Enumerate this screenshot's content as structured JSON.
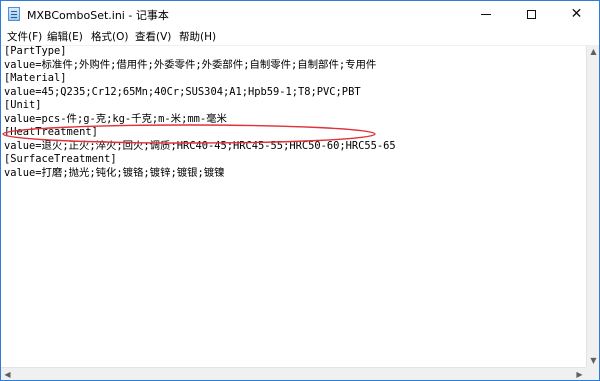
{
  "window": {
    "title": "MXBComboSet.ini - 记事本"
  },
  "titlebar_buttons": {
    "minimize_icon": "minimize-icon",
    "maximize_icon": "maximize-icon",
    "close": "✕"
  },
  "menu": [
    {
      "label": "文件(F)"
    },
    {
      "label": "编辑(E)"
    },
    {
      "label": "格式(O)"
    },
    {
      "label": "查看(V)"
    },
    {
      "label": "帮助(H)"
    }
  ],
  "document": {
    "lines": [
      "[PartType]",
      "value=标准件;外购件;借用件;外委零件;外委部件;自制零件;自制部件;专用件",
      "[Material]",
      "value=45;Q235;Cr12;65Mn;40Cr;SUS304;A1;Hpb59-1;T8;PVC;PBT",
      "[Unit]",
      "value=pcs-件;g-克;kg-千克;m-米;mm-毫米",
      "[HeatTreatment]",
      "value=退火;正火;淬火;回火;调质;HRC40-45;HRC45-55;HRC50-60;HRC55-65",
      "[SurfaceTreatment]",
      "value=打磨;抛光;钝化;镀铬;镀锌;镀银;镀镍"
    ]
  },
  "annotation": {
    "color": "#e0323a"
  },
  "colors": {
    "window_border": "#2b7dd6",
    "scrollbar_bg": "#f0f0f0"
  }
}
